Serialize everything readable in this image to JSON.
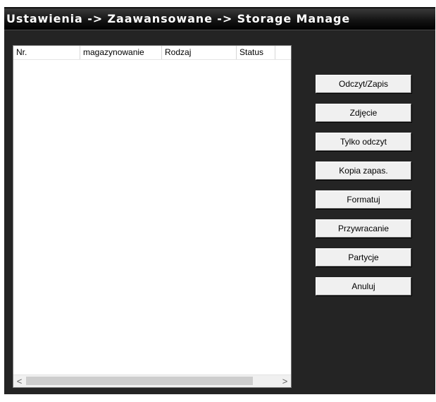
{
  "window": {
    "title": "Ustawienia -> Zaawansowane -> Storage Manage"
  },
  "table": {
    "columns": [
      "Nr.",
      "magazynowanie",
      "Rodzaj",
      "Status"
    ],
    "rows": []
  },
  "scrollbar": {
    "left_icon": "chevron-left-icon",
    "right_icon": "chevron-right-icon",
    "left_glyph": "<",
    "right_glyph": ">"
  },
  "buttons": {
    "read_write": "Odczyt/Zapis",
    "snapshot": "Zdjęcie",
    "read_only": "Tylko odczyt",
    "backup": "Kopia zapas.",
    "format": "Formatuj",
    "restore": "Przywracanie",
    "partition": "Partycje",
    "cancel": "Anuluj"
  },
  "colors": {
    "panel_background": "#242424",
    "title_bar": "#000000",
    "title_text": "#ffffff",
    "button_face": "#f0f0f0"
  }
}
